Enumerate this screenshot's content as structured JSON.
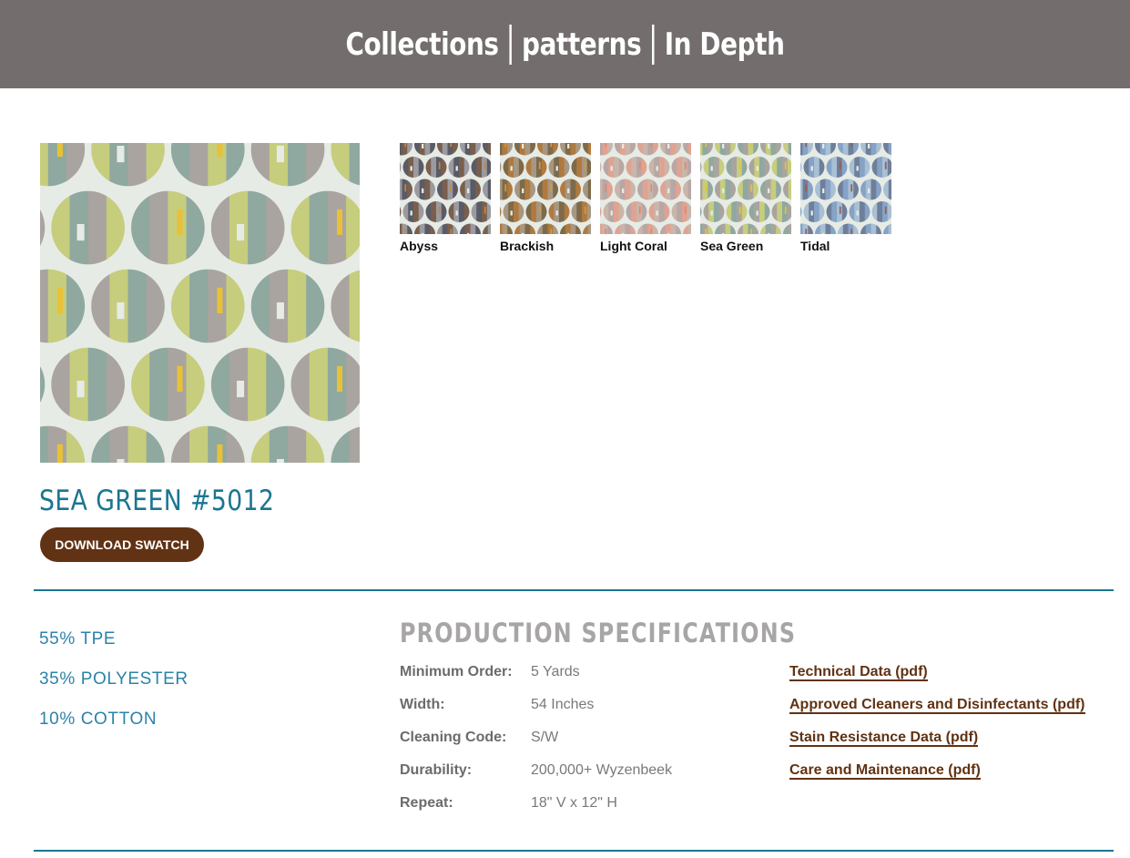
{
  "header": {
    "breadcrumbs": [
      {
        "label": "Collections"
      },
      {
        "label": "patterns"
      },
      {
        "label": "In Depth"
      }
    ]
  },
  "product": {
    "title": "SEA GREEN #5012",
    "download_label": "DOWNLOAD SWATCH",
    "swatch_colors": [
      "#8fa8a0",
      "#a9a49f",
      "#c6cd7d",
      "#e9c136"
    ]
  },
  "colorways": [
    {
      "name": "Abyss",
      "colors": [
        "#7a5f4d",
        "#9b9aa0",
        "#5a5b66",
        "#c8863a"
      ]
    },
    {
      "name": "Brackish",
      "colors": [
        "#b07a3f",
        "#a79782",
        "#7d6a4a",
        "#d39a3c"
      ]
    },
    {
      "name": "Light Coral",
      "colors": [
        "#e1a391",
        "#c9b5aa",
        "#b7a7a5",
        "#e7856b"
      ]
    },
    {
      "name": "Sea Green",
      "colors": [
        "#8fa8a0",
        "#a9a49f",
        "#c6cd7d",
        "#e9c136"
      ]
    },
    {
      "name": "Tidal",
      "colors": [
        "#86a3c6",
        "#a8c0d4",
        "#6f7f9a",
        "#9d5a4e"
      ]
    }
  ],
  "content": [
    "55% TPE",
    "35% POLYESTER",
    "10% COTTON"
  ],
  "specs": {
    "title": "PRODUCTION SPECIFICATIONS",
    "rows": [
      {
        "label": "Minimum Order:",
        "value": "5 Yards"
      },
      {
        "label": "Width:",
        "value": "54 Inches"
      },
      {
        "label": "Cleaning Code:",
        "value": "S/W"
      },
      {
        "label": "Durability:",
        "value": "200,000+ Wyzenbeek"
      },
      {
        "label": "Repeat:",
        "value": "18\" V x 12\" H"
      }
    ]
  },
  "documents": [
    "Technical Data (pdf)",
    "Approved Cleaners and Disinfectants (pdf)",
    "Stain Resistance Data (pdf)",
    "Care and Maintenance (pdf)"
  ],
  "theme": {
    "header_bg": "#736d6d",
    "accent_teal": "#1b7690",
    "button_brown": "#613213",
    "fabric_bg": "#e6ebe6"
  }
}
